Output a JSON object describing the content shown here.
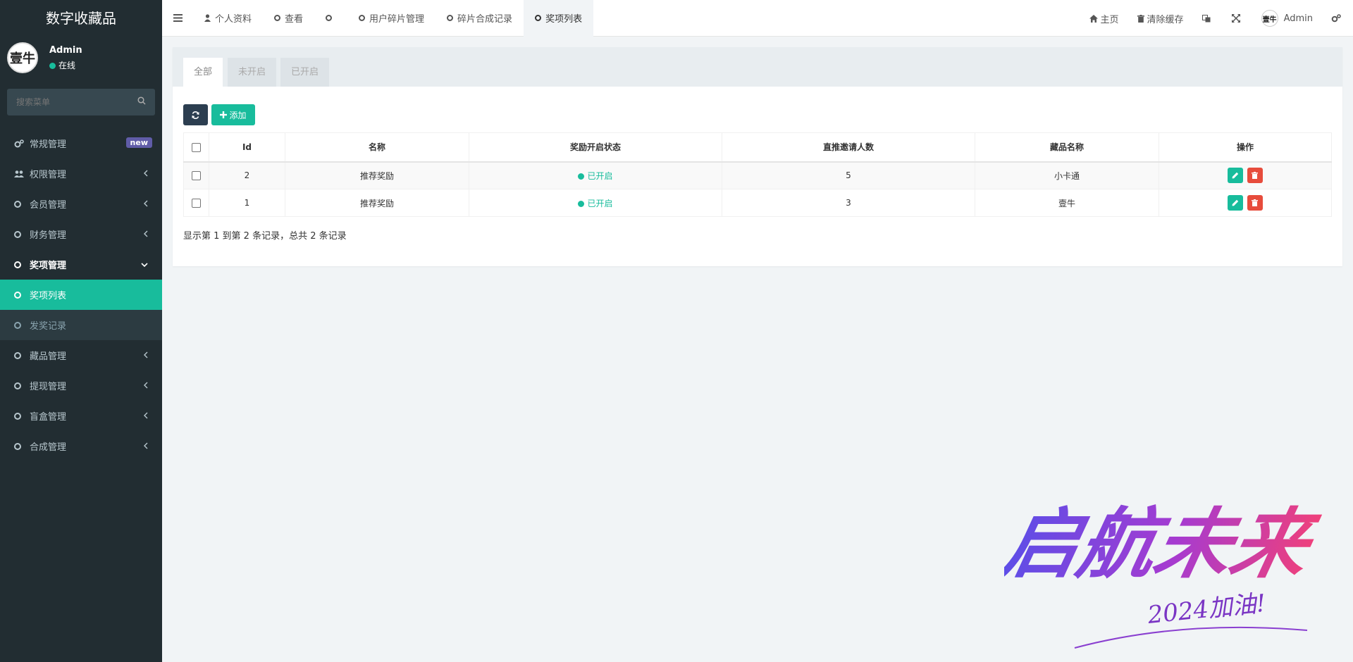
{
  "sidebar": {
    "brand": "数字收藏品",
    "user": {
      "avatar_text": "壹牛",
      "name": "Admin",
      "status": "在线"
    },
    "search_placeholder": "搜索菜单",
    "menu": [
      {
        "label": "常规管理",
        "badge": "new"
      },
      {
        "label": "权限管理"
      },
      {
        "label": "会员管理"
      },
      {
        "label": "财务管理"
      },
      {
        "label": "奖项管理"
      },
      {
        "label": "奖项列表"
      },
      {
        "label": "发奖记录"
      },
      {
        "label": "藏品管理"
      },
      {
        "label": "提现管理"
      },
      {
        "label": "盲盒管理"
      },
      {
        "label": "合成管理"
      }
    ]
  },
  "topnav": {
    "tabs": [
      {
        "label": "个人资料"
      },
      {
        "label": "查看"
      },
      {
        "label": ""
      },
      {
        "label": "用户碎片管理"
      },
      {
        "label": "碎片合成记录"
      },
      {
        "label": "奖项列表"
      }
    ],
    "home": "主页",
    "clear_cache": "清除缓存",
    "user_name": "Admin"
  },
  "panel": {
    "tabs": [
      "全部",
      "未开启",
      "已开启"
    ],
    "add_label": "添加",
    "columns": [
      "Id",
      "名称",
      "奖励开启状态",
      "直推邀请人数",
      "藏品名称",
      "操作"
    ],
    "rows": [
      {
        "id": "2",
        "name": "推荐奖励",
        "status": "已开启",
        "invites": "5",
        "collection": "小卡通"
      },
      {
        "id": "1",
        "name": "推荐奖励",
        "status": "已开启",
        "invites": "3",
        "collection": "壹牛"
      }
    ],
    "page_info": "显示第 1 到第 2 条记录，总共 2 条记录"
  },
  "decoration": {
    "main_text": "启航未来",
    "sub_text": "2024加油!"
  },
  "colors": {
    "sidebar_bg": "#222d32",
    "accent": "#18bc9c",
    "danger": "#e74c3c",
    "badge": "#605ca8",
    "dark_button": "#2c3e50"
  }
}
